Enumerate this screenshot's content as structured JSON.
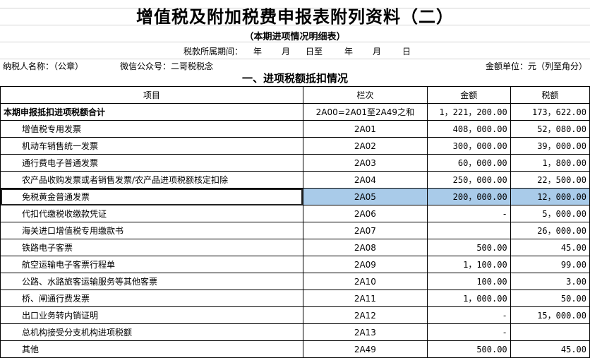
{
  "title": "增值税及附加税费申报表附列资料（二）",
  "subtitle": "（本期进项情况明细表）",
  "period": {
    "label": "税款所属期间：",
    "year1": "年",
    "month1": "月",
    "day1_to": "日至",
    "year2": "年",
    "month2": "月",
    "day2": "日"
  },
  "taxpayer": {
    "label": "纳税人名称：（公章）",
    "wechat": "微信公众号：二哥税税念",
    "unit": "金额单位：元（列至角分）"
  },
  "section_title": "一、进项税额抵扣情况",
  "headers": {
    "item": "项目",
    "code": "栏次",
    "amount": "金额",
    "tax": "税额"
  },
  "rows": [
    {
      "name": "本期申报抵扣进项税额合计",
      "code": "2A00=2A01至2A49之和",
      "amount": "1，221，200.00",
      "tax": "173，622.00"
    },
    {
      "name": "增值税专用发票",
      "code": "2A01",
      "amount": "408，000.00",
      "tax": "52，080.00"
    },
    {
      "name": "机动车销售统一发票",
      "code": "2A02",
      "amount": "300，000.00",
      "tax": "39，000.00"
    },
    {
      "name": "通行费电子普通发票",
      "code": "2A03",
      "amount": "60，000.00",
      "tax": "1，800.00"
    },
    {
      "name": "农产品收购发票或者销售发票/农产品进项税额核定扣除",
      "code": "2A04",
      "amount": "250，000.00",
      "tax": "22，500.00"
    },
    {
      "name": "免税黄金普通发票",
      "code": "2A05",
      "amount": "200，000.00",
      "tax": "12，000.00"
    },
    {
      "name": "代扣代缴税收缴款凭证",
      "code": "2A06",
      "amount": "-",
      "tax": "5，000.00"
    },
    {
      "name": "海关进口增值税专用缴款书",
      "code": "2A07",
      "amount": "",
      "tax": "26，000.00"
    },
    {
      "name": "铁路电子客票",
      "code": "2A08",
      "amount": "500.00",
      "tax": "45.00"
    },
    {
      "name": "航空运输电子客票行程单",
      "code": "2A09",
      "amount": "1，100.00",
      "tax": "99.00"
    },
    {
      "name": "公路、水路旅客运输服务等其他客票",
      "code": "2A10",
      "amount": "100.00",
      "tax": "3.00"
    },
    {
      "name": "桥、闸通行费发票",
      "code": "2A11",
      "amount": "1，000.00",
      "tax": "50.00"
    },
    {
      "name": "出口业务转内销证明",
      "code": "2A12",
      "amount": "-",
      "tax": "15，000.00"
    },
    {
      "name": "总机构接受分支机构进项税额",
      "code": "2A13",
      "amount": "-",
      "tax": ""
    },
    {
      "name": "其他",
      "code": "2A49",
      "amount": "500.00",
      "tax": "45.00"
    }
  ]
}
